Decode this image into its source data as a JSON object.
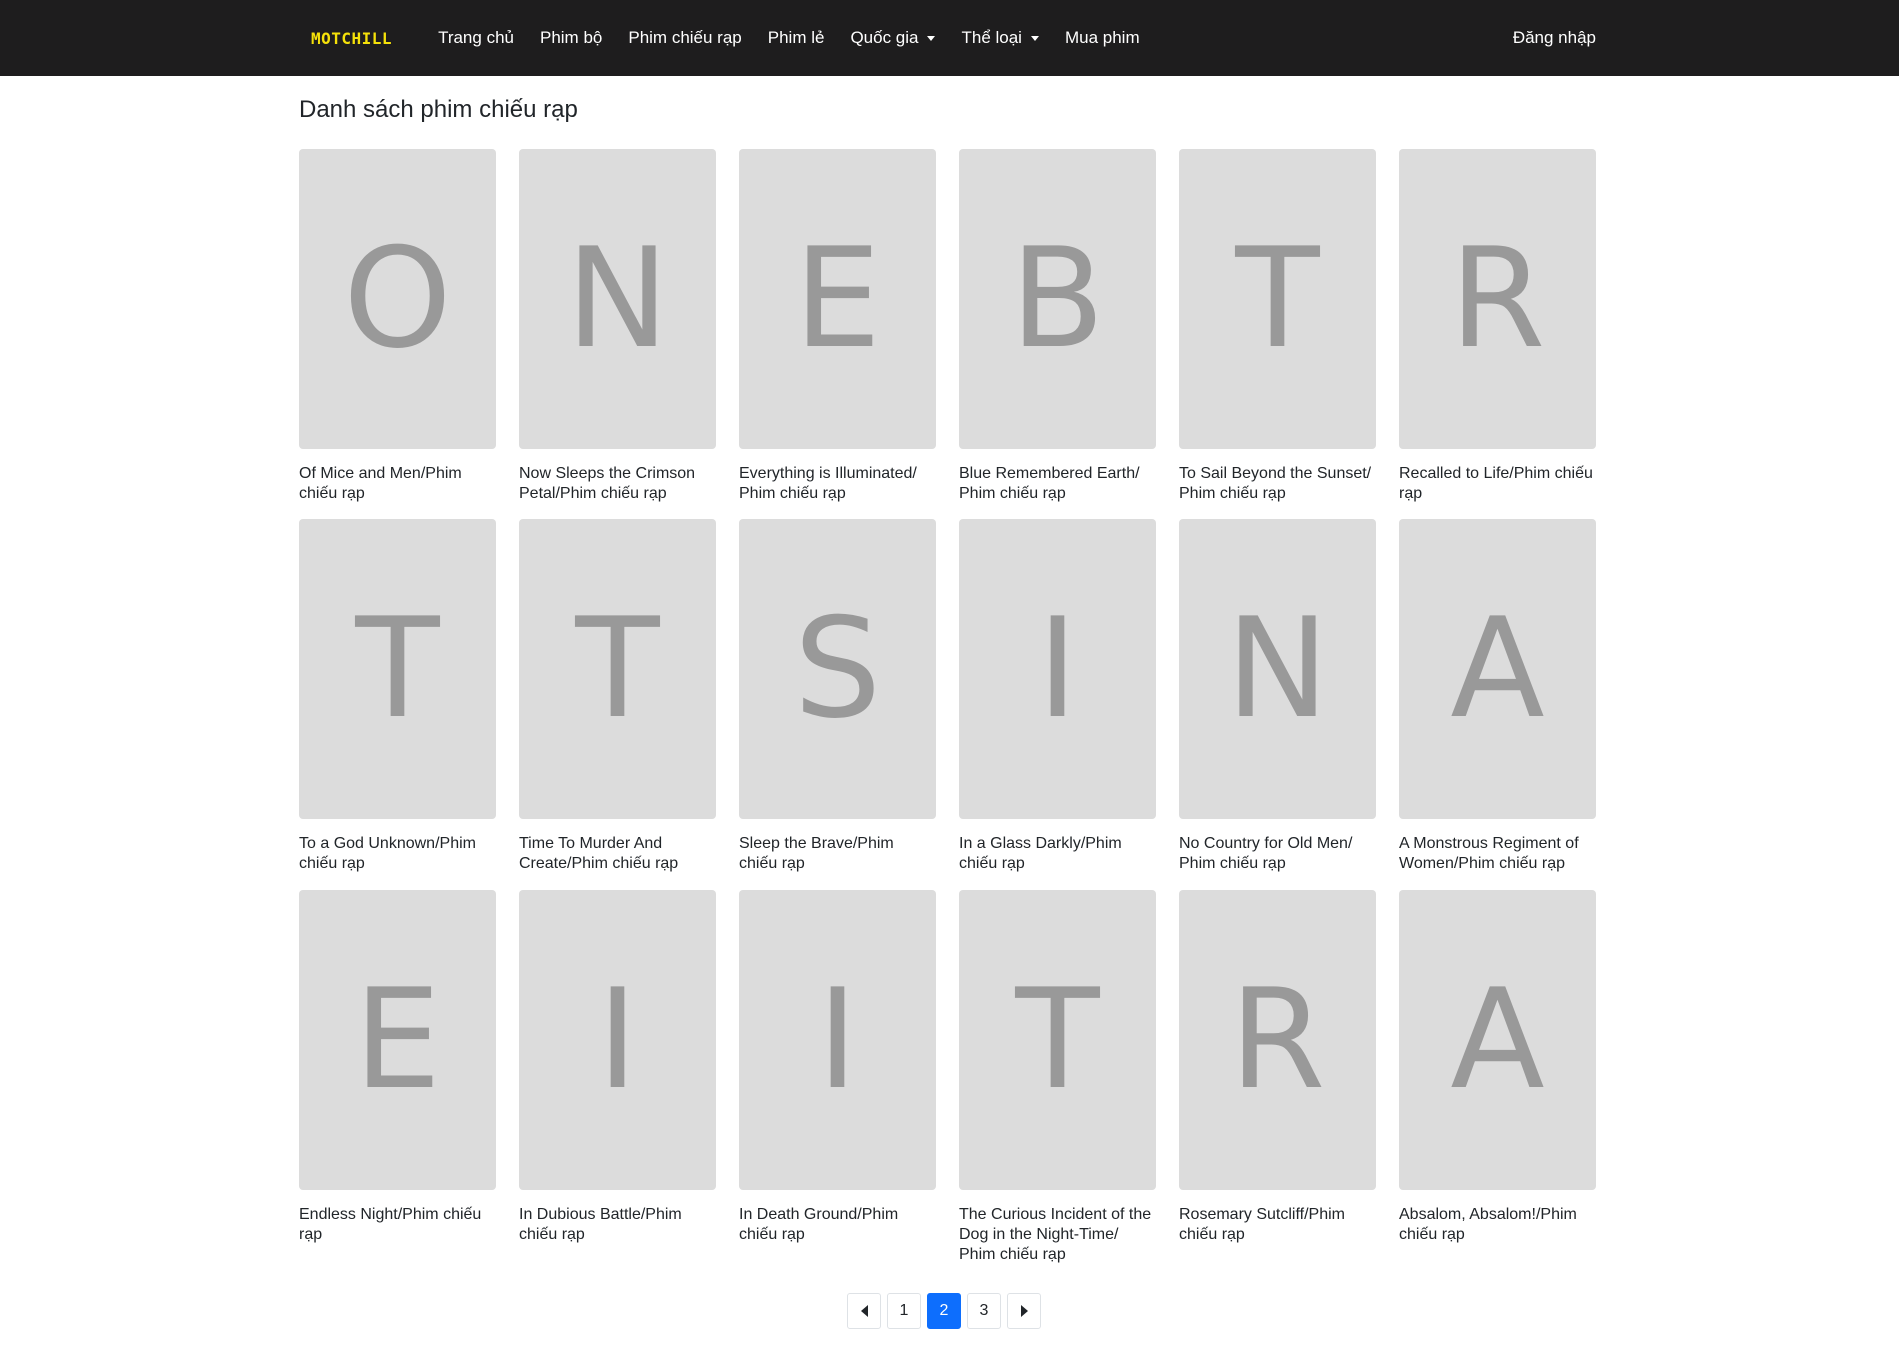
{
  "navbar": {
    "brand": "MOTCHILL",
    "links": [
      {
        "label": "Trang chủ",
        "dropdown": false
      },
      {
        "label": "Phim bộ",
        "dropdown": false
      },
      {
        "label": "Phim chiếu rạp",
        "dropdown": false
      },
      {
        "label": "Phim lẻ",
        "dropdown": false
      },
      {
        "label": "Quốc gia",
        "dropdown": true
      },
      {
        "label": "Thể loại",
        "dropdown": true
      },
      {
        "label": "Mua phim",
        "dropdown": false
      }
    ],
    "login": "Đăng nhập"
  },
  "page": {
    "title": "Danh sách phim chiếu rạp"
  },
  "movies": [
    {
      "letter": "O",
      "title": "Of Mice and Men/Phim chiếu rạp"
    },
    {
      "letter": "N",
      "title": "Now Sleeps the Crimson Petal/Phim chiếu rạp"
    },
    {
      "letter": "E",
      "title": "Everything is Illuminated/ Phim chiếu rạp"
    },
    {
      "letter": "B",
      "title": "Blue Remembered Earth/ Phim chiếu rạp"
    },
    {
      "letter": "T",
      "title": "To Sail Beyond the Sunset/ Phim chiếu rạp"
    },
    {
      "letter": "R",
      "title": "Recalled to Life/Phim chiếu rạp"
    },
    {
      "letter": "T",
      "title": "To a God Unknown/Phim chiếu rạp"
    },
    {
      "letter": "T",
      "title": "Time To Murder And Create/Phim chiếu rạp"
    },
    {
      "letter": "S",
      "title": "Sleep the Brave/Phim chiếu rạp"
    },
    {
      "letter": "I",
      "title": "In a Glass Darkly/Phim chiếu rạp"
    },
    {
      "letter": "N",
      "title": "No Country for Old Men/ Phim chiếu rạp"
    },
    {
      "letter": "A",
      "title": "A Monstrous Regiment of Women/Phim chiếu rạp"
    },
    {
      "letter": "E",
      "title": "Endless Night/Phim chiếu rạp"
    },
    {
      "letter": "I",
      "title": "In Dubious Battle/Phim chiếu rạp"
    },
    {
      "letter": "I",
      "title": "In Death Ground/Phim chiếu rạp"
    },
    {
      "letter": "T",
      "title": "The Curious Incident of the Dog in the Night-Time/ Phim chiếu rạp"
    },
    {
      "letter": "R",
      "title": "Rosemary Sutcliff/Phim chiếu rạp"
    },
    {
      "letter": "A",
      "title": "Absalom, Absalom!/Phim chiếu rạp"
    }
  ],
  "pagination": {
    "prev_icon": "caret-left-icon",
    "next_icon": "caret-right-icon",
    "pages": [
      "1",
      "2",
      "3"
    ],
    "current": "2",
    "active_color": "#0d6efd"
  },
  "colors": {
    "navbar_bg": "#1e1d1e",
    "brand": "#f5e10a",
    "poster_bg": "#dcdcdc",
    "poster_letter": "#999999"
  }
}
